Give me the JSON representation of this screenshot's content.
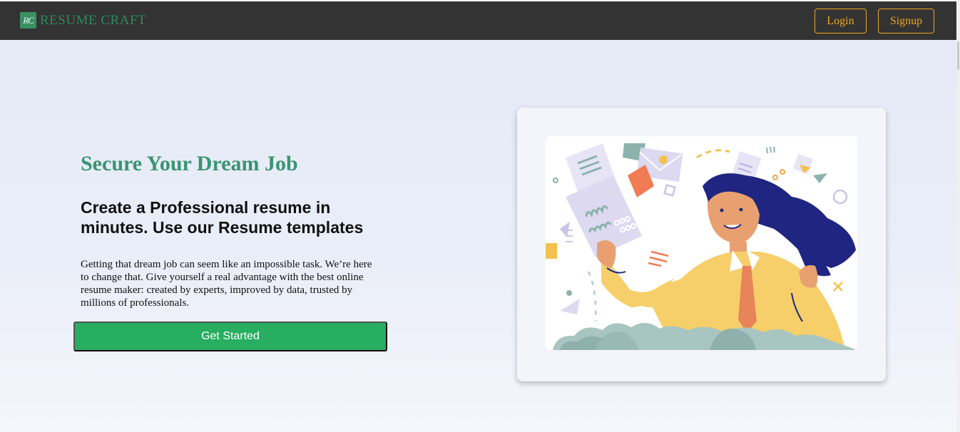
{
  "navbar": {
    "logo_mark": "RC",
    "logo_text": "RESUME CRAFT",
    "login_label": "Login",
    "signup_label": "Signup"
  },
  "hero": {
    "subtitle": "Secure Your Dream Job",
    "title": "Create a Professional resume in minutes. Use our Resume templates",
    "description": "Getting that dream job can seem like an impossible task. We’re here to change that. Give yourself a real advantage with the best online resume maker: created by experts, improved by data, trusted by millions of professionals.",
    "cta_label": "Get Started"
  },
  "illustration": {
    "icon": "woman-holding-resume-illustration"
  },
  "colors": {
    "navbar_bg": "#333333",
    "brand_green": "#2f8a5e",
    "accent_orange": "#f0a81a",
    "cta_green": "#27ae60"
  }
}
